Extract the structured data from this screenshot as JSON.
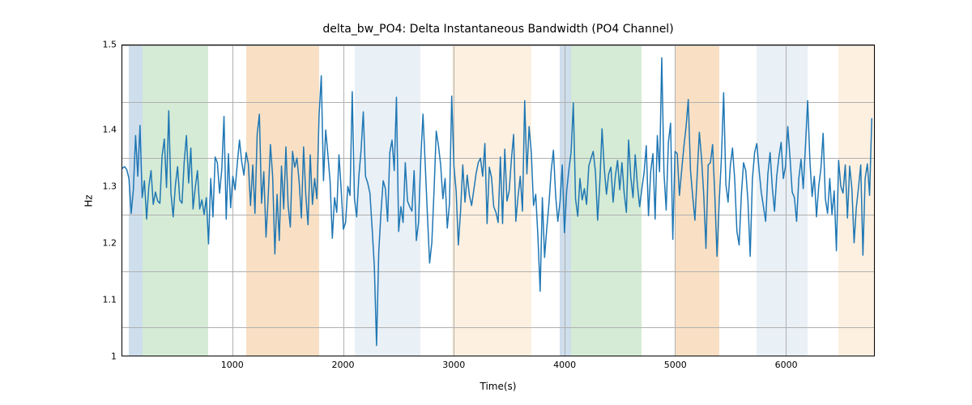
{
  "chart_data": {
    "type": "line",
    "title": "delta_bw_PO4: Delta Instantaneous Bandwidth (PO4 Channel)",
    "xlabel": "Time(s)",
    "ylabel": "Hz",
    "xlim": [
      0,
      6800
    ],
    "ylim": [
      0.95,
      1.5
    ],
    "xticks": [
      1000,
      2000,
      3000,
      4000,
      5000,
      6000
    ],
    "yticks": [
      1.0,
      1.1,
      1.2,
      1.3,
      1.4,
      1.5
    ],
    "bands": [
      {
        "x0": 60,
        "x1": 180,
        "color": "#b4cde2",
        "alpha": 0.65
      },
      {
        "x0": 180,
        "x1": 780,
        "color": "#c3e2c3",
        "alpha": 0.7
      },
      {
        "x0": 1120,
        "x1": 1780,
        "color": "#f7d6b0",
        "alpha": 0.75
      },
      {
        "x0": 2100,
        "x1": 2700,
        "color": "#d7e3ef",
        "alpha": 0.55
      },
      {
        "x0": 2980,
        "x1": 3700,
        "color": "#fbe6cc",
        "alpha": 0.6
      },
      {
        "x0": 3960,
        "x1": 4060,
        "color": "#b4cde2",
        "alpha": 0.65
      },
      {
        "x0": 4060,
        "x1": 4700,
        "color": "#c3e2c3",
        "alpha": 0.7
      },
      {
        "x0": 5000,
        "x1": 5400,
        "color": "#f7d6b0",
        "alpha": 0.75
      },
      {
        "x0": 5740,
        "x1": 6200,
        "color": "#d7e3ef",
        "alpha": 0.55
      },
      {
        "x0": 6480,
        "x1": 6800,
        "color": "#fbe6cc",
        "alpha": 0.6
      }
    ],
    "series": [
      {
        "name": "delta_bw_PO4",
        "color": "#1f77b4",
        "x_start": 0,
        "x_step": 20,
        "values": [
          1.282,
          1.285,
          1.28,
          1.264,
          1.202,
          1.244,
          1.34,
          1.268,
          1.358,
          1.23,
          1.26,
          1.192,
          1.25,
          1.278,
          1.218,
          1.24,
          1.224,
          1.22,
          1.304,
          1.334,
          1.248,
          1.384,
          1.238,
          1.196,
          1.252,
          1.285,
          1.226,
          1.22,
          1.294,
          1.34,
          1.256,
          1.318,
          1.21,
          1.248,
          1.278,
          1.21,
          1.226,
          1.2,
          1.23,
          1.148,
          1.264,
          1.196,
          1.302,
          1.292,
          1.238,
          1.28,
          1.374,
          1.192,
          1.308,
          1.212,
          1.268,
          1.244,
          1.29,
          1.332,
          1.294,
          1.27,
          1.31,
          1.29,
          1.216,
          1.288,
          1.202,
          1.342,
          1.378,
          1.22,
          1.276,
          1.16,
          1.232,
          1.324,
          1.268,
          1.13,
          1.236,
          1.154,
          1.286,
          1.21,
          1.32,
          1.216,
          1.178,
          1.312,
          1.284,
          1.3,
          1.258,
          1.194,
          1.32,
          1.234,
          1.182,
          1.306,
          1.218,
          1.264,
          1.228,
          1.376,
          1.446,
          1.26,
          1.35,
          1.306,
          1.258,
          1.158,
          1.23,
          1.204,
          1.306,
          1.244,
          1.174,
          1.186,
          1.25,
          1.234,
          1.418,
          1.228,
          1.196,
          1.268,
          1.314,
          1.382,
          1.268,
          1.256,
          1.238,
          1.176,
          1.108,
          0.968,
          1.134,
          1.204,
          1.26,
          1.246,
          1.188,
          1.31,
          1.332,
          1.278,
          1.408,
          1.17,
          1.214,
          1.186,
          1.292,
          1.224,
          1.214,
          1.206,
          1.278,
          1.154,
          1.186,
          1.298,
          1.378,
          1.29,
          1.2,
          1.114,
          1.15,
          1.242,
          1.348,
          1.322,
          1.288,
          1.228,
          1.264,
          1.176,
          1.22,
          1.41,
          1.286,
          1.242,
          1.146,
          1.206,
          1.288,
          1.222,
          1.27,
          1.234,
          1.216,
          1.244,
          1.272,
          1.292,
          1.3,
          1.268,
          1.326,
          1.184,
          1.284,
          1.266,
          1.214,
          1.204,
          1.186,
          1.302,
          1.184,
          1.316,
          1.224,
          1.242,
          1.298,
          1.342,
          1.188,
          1.232,
          1.268,
          1.206,
          1.402,
          1.272,
          1.356,
          1.31,
          1.216,
          1.236,
          1.16,
          1.064,
          1.23,
          1.124,
          1.176,
          1.22,
          1.278,
          1.314,
          1.234,
          1.188,
          1.224,
          1.288,
          1.168,
          1.242,
          1.28,
          1.31,
          1.398,
          1.228,
          1.197,
          1.264,
          1.226,
          1.246,
          1.218,
          1.286,
          1.3,
          1.312,
          1.276,
          1.19,
          1.258,
          1.352,
          1.282,
          1.236,
          1.272,
          1.284,
          1.222,
          1.268,
          1.296,
          1.244,
          1.292,
          1.238,
          1.204,
          1.332,
          1.266,
          1.23,
          1.306,
          1.252,
          1.214,
          1.246,
          1.274,
          1.322,
          1.198,
          1.276,
          1.308,
          1.192,
          1.34,
          1.276,
          1.478,
          1.274,
          1.208,
          1.328,
          1.362,
          1.156,
          1.312,
          1.308,
          1.234,
          1.278,
          1.32,
          1.356,
          1.404,
          1.278,
          1.232,
          1.19,
          1.268,
          1.346,
          1.3,
          1.234,
          1.14,
          1.288,
          1.292,
          1.324,
          1.234,
          1.126,
          1.224,
          1.302,
          1.416,
          1.254,
          1.222,
          1.286,
          1.318,
          1.262,
          1.17,
          1.146,
          1.234,
          1.292,
          1.278,
          1.224,
          1.126,
          1.262,
          1.31,
          1.326,
          1.28,
          1.24,
          1.214,
          1.188,
          1.272,
          1.31,
          1.248,
          1.206,
          1.268,
          1.302,
          1.328,
          1.264,
          1.286,
          1.356,
          1.302,
          1.24,
          1.23,
          1.188,
          1.264,
          1.298,
          1.246,
          1.322,
          1.402,
          1.296,
          1.232,
          1.268,
          1.196,
          1.25,
          1.282,
          1.344,
          1.228,
          1.202,
          1.264,
          1.2,
          1.242,
          1.136,
          1.296,
          1.25,
          1.238,
          1.288,
          1.194,
          1.286,
          1.246,
          1.15,
          1.212,
          1.248,
          1.288,
          1.128,
          1.264,
          1.29,
          1.234,
          1.37
        ]
      }
    ]
  }
}
